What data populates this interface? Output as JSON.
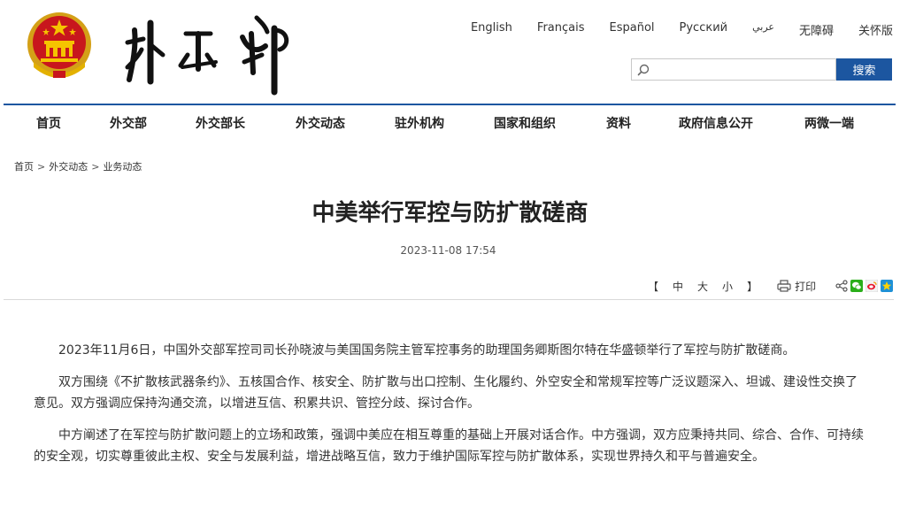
{
  "header": {
    "languages": [
      "English",
      "Français",
      "Español",
      "Русский",
      "عربي",
      "无障碍",
      "关怀版"
    ],
    "search": {
      "placeholder": "",
      "button_label": "搜索"
    }
  },
  "nav": {
    "items": [
      "首页",
      "外交部",
      "外交部长",
      "外交动态",
      "驻外机构",
      "国家和组织",
      "资料",
      "政府信息公开",
      "两微一端"
    ]
  },
  "breadcrumb": {
    "items": [
      "首页",
      "外交动态",
      "业务动态"
    ],
    "separator": ">"
  },
  "article": {
    "title": "中美举行军控与防扩散磋商",
    "date": "2023-11-08 17:54",
    "paragraphs": [
      "2023年11月6日，中国外交部军控司司长孙晓波与美国国务院主管军控事务的助理国务卿斯图尔特在华盛顿举行了军控与防扩散磋商。",
      "双方围绕《不扩散核武器条约》、五核国合作、核安全、防扩散与出口控制、生化履约、外空安全和常规军控等广泛议题深入、坦诚、建设性交换了意见。双方强调应保持沟通交流，以增进互信、积累共识、管控分歧、探讨合作。",
      "中方阐述了在军控与防扩散问题上的立场和政策，强调中美应在相互尊重的基础上开展对话合作。中方强调，双方应秉持共同、综合、合作、可持续的安全观，切实尊重彼此主权、安全与发展利益，增进战略互信，致力于维护国际军控与防扩散体系，实现世界持久和平与普遍安全。"
    ]
  },
  "toolbar": {
    "bracket_open": "【",
    "size_large": "中",
    "size_medium": "大",
    "size_small": "小",
    "bracket_close": "】",
    "print_label": "打印"
  },
  "colors": {
    "accent": "#1c56a0",
    "divider": "#d9d9d9"
  }
}
